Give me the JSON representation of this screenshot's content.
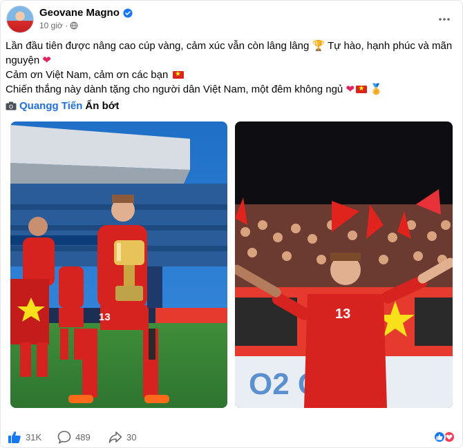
{
  "post": {
    "author": "Geovane Magno",
    "time": "10 giờ ·",
    "lines": [
      "Lần đầu tiên được nâng cao cúp vàng, cảm xúc vẫn còn lâng lâng 🏆 Tự hào, hạnh phúc và mãn nguyện",
      "Cảm ơn Việt Nam, cảm ơn các bạn",
      "Chiến thắng này dành tặng cho người dân Việt Nam, một đêm không ngủ"
    ],
    "credit_name": "Quangg Tiến",
    "credit_hide": "Ẩn bớt",
    "photo1_alt": "Player holding trophy",
    "photo2_alt": "Player celebrating with fans",
    "likes": "31K",
    "comments": "489",
    "shares": "30"
  },
  "icons": {
    "verified": "verified-badge-icon",
    "globe": "globe-icon",
    "more": "more-options-icon",
    "camera": "camera-icon",
    "like": "thumbs-up-icon",
    "comment": "comment-icon",
    "share": "share-icon",
    "react_like": "like-reaction-icon",
    "react_love": "love-reaction-icon"
  },
  "colors": {
    "brand_blue": "#1877f2",
    "link": "#216fdb",
    "secondary_text": "#65676b",
    "love": "#f33e58"
  }
}
